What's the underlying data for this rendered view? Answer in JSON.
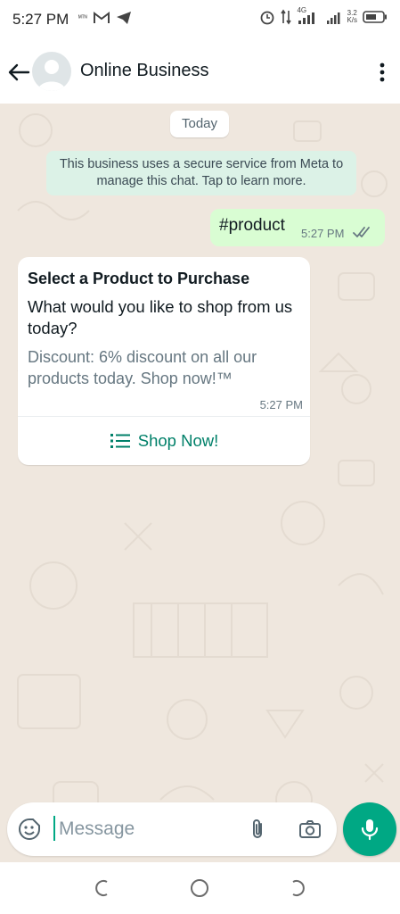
{
  "status_bar": {
    "time": "5:27 PM",
    "carrier_label": "ᴹᵀᴺ",
    "network_label": "4G",
    "speed_value": "3.2",
    "speed_unit": "K/s",
    "icons": [
      "mtn-icon",
      "gmail-icon",
      "telegram-icon",
      "alarm-icon",
      "data-arrows-icon",
      "signal-icon",
      "battery-icon"
    ]
  },
  "header": {
    "title": "Online Business",
    "back_icon": "arrow-left-icon",
    "menu_icon": "more-vertical-icon"
  },
  "chat": {
    "date_chip": "Today",
    "system_notice": "This business uses a secure service from Meta to manage this chat. Tap to learn more.",
    "outgoing": {
      "text": "#product",
      "time": "5:27 PM",
      "status_icon": "double-check-icon"
    },
    "interactive_card": {
      "title": "Select a Product to Purchase",
      "body": "What would you like to shop from us today?",
      "footer": "Discount: 6% discount on all our products today. Shop now!™",
      "time": "5:27 PM",
      "action_label": "Shop Now!",
      "action_icon": "list-icon",
      "accent_color": "#008069"
    }
  },
  "composer": {
    "placeholder": "Message",
    "value": "",
    "emoji_icon": "sticker-icon",
    "attach_icon": "paperclip-icon",
    "camera_icon": "camera-icon",
    "mic_icon": "mic-icon",
    "mic_color": "#00a884"
  },
  "nav_bar": {
    "icons": [
      "recents-icon",
      "home-icon",
      "back-icon"
    ]
  }
}
